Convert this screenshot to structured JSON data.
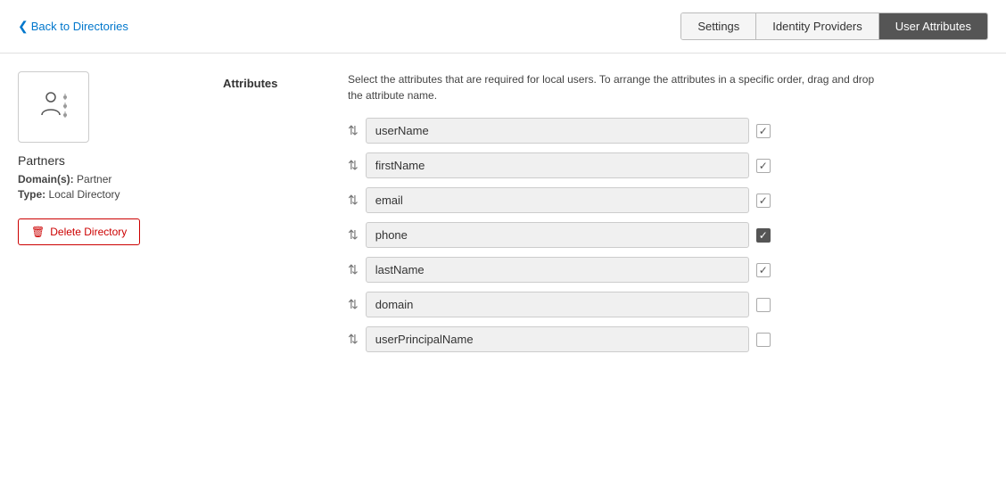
{
  "header": {
    "back_label": "Back to Directories",
    "tabs": [
      {
        "id": "settings",
        "label": "Settings",
        "active": false
      },
      {
        "id": "identity-providers",
        "label": "Identity Providers",
        "active": false
      },
      {
        "id": "user-attributes",
        "label": "User Attributes",
        "active": true
      }
    ]
  },
  "sidebar": {
    "directory_name": "Partners",
    "domains_label": "Domain(s):",
    "domains_value": "Partner",
    "type_label": "Type:",
    "type_value": "Local Directory",
    "delete_label": "Delete Directory"
  },
  "content": {
    "section_label": "Attributes",
    "description": "Select the attributes that are required for local users. To arrange the attributes in a specific order, drag and drop the attribute name.",
    "attributes": [
      {
        "name": "userName",
        "checked": true,
        "checked_solid": false
      },
      {
        "name": "firstName",
        "checked": true,
        "checked_solid": false
      },
      {
        "name": "email",
        "checked": true,
        "checked_solid": false
      },
      {
        "name": "phone",
        "checked": true,
        "checked_solid": true
      },
      {
        "name": "lastName",
        "checked": true,
        "checked_solid": false
      },
      {
        "name": "domain",
        "checked": false,
        "checked_solid": false
      },
      {
        "name": "userPrincipalName",
        "checked": false,
        "checked_solid": false
      }
    ]
  },
  "icons": {
    "chevron_left": "❮",
    "drag_handle": "⇅",
    "checkmark": "✓",
    "trash": "🗑"
  }
}
